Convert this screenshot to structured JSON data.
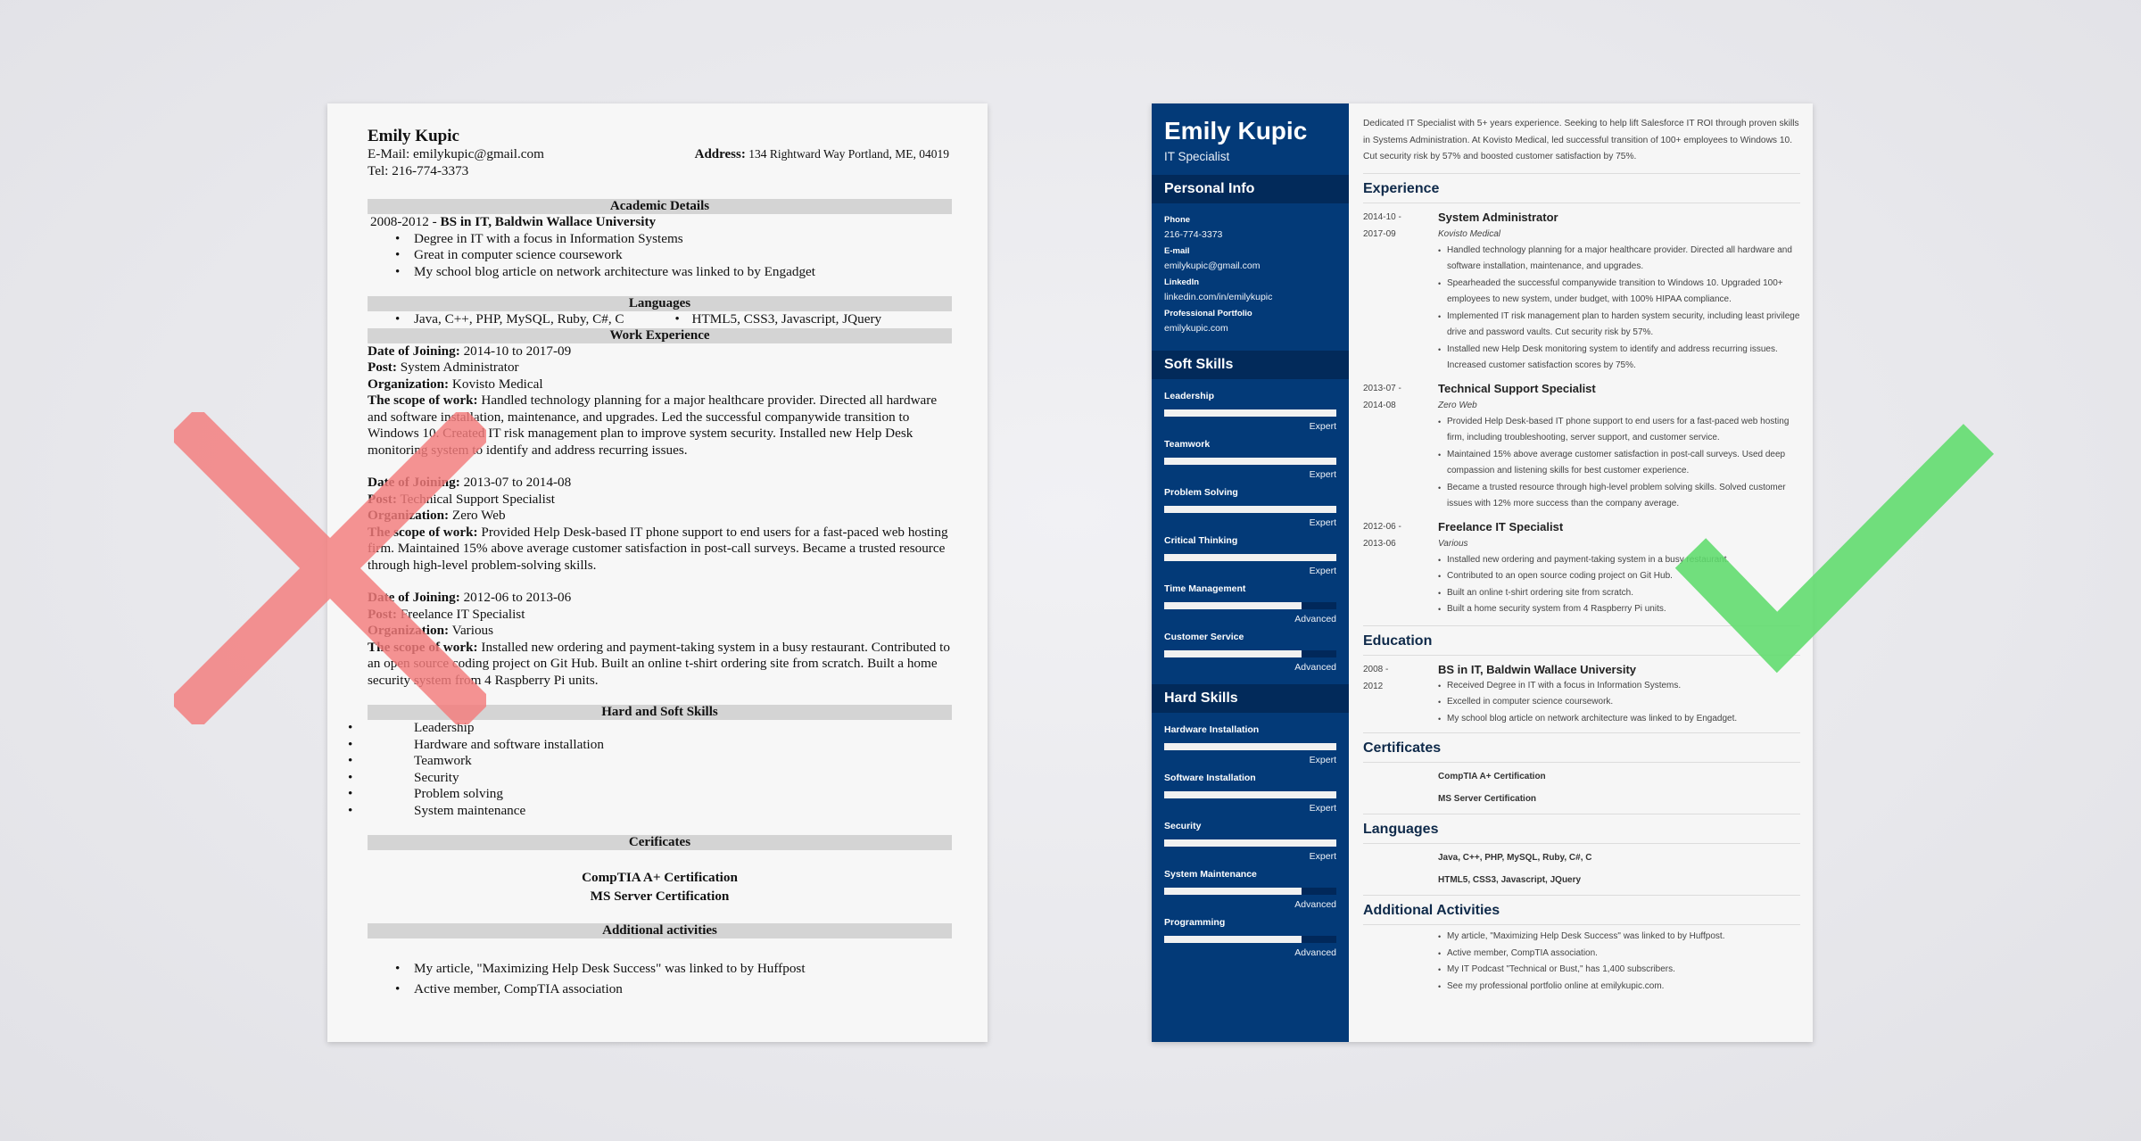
{
  "bad_resume": {
    "name": "Emily Kupic",
    "email_label": "E-Mail:",
    "email": "emilykupic@gmail.com",
    "address_label": "Address:",
    "address": "134 Rightward Way Portland, ME, 04019",
    "tel_label": "Tel:",
    "tel": "216-774-3373",
    "academic": {
      "heading": "Academic Details",
      "years": "2008-2012 - ",
      "degree": "BS in IT, Baldwin Wallace University",
      "bullets": [
        "Degree in IT with a focus in Information Systems",
        "Great in computer science coursework",
        "My school blog article on network architecture was linked to by Engadget"
      ]
    },
    "languages": {
      "heading": "Languages",
      "left": "Java, C++, PHP, MySQL, Ruby, C#, C",
      "right": "HTML5, CSS3, Javascript, JQuery"
    },
    "work": {
      "heading": "Work Experience",
      "labels": {
        "date": "Date of Joining:",
        "post": "Post:",
        "org": "Organization:",
        "scope": "The scope of work:"
      },
      "jobs": [
        {
          "dates": "2014-10 to 2017-09",
          "post": "System Administrator",
          "org": "Kovisto Medical",
          "scope": "Handled technology planning for a major healthcare provider. Directed all hardware and software installation, maintenance, and upgrades. Led the successful companywide transition to Windows 10. Created IT risk management plan to improve system security. Installed new Help Desk monitoring system to identify and address recurring issues."
        },
        {
          "dates": "2013-07 to 2014-08",
          "post": "Technical Support Specialist",
          "org": "Zero Web",
          "scope": "Provided Help Desk-based IT phone support to end users for a fast-paced web hosting firm. Maintained 15% above average customer satisfaction in post-call surveys. Became a trusted resource through high-level problem-solving skills."
        },
        {
          "dates": "2012-06 to 2013-06",
          "post": "Freelance IT Specialist",
          "org": "Various",
          "scope": "Installed new ordering and payment-taking system in a busy restaurant. Contributed to an open source coding project on Git Hub. Built an online t-shirt ordering site from scratch. Built a home security system from 4 Raspberry Pi units."
        }
      ]
    },
    "skills": {
      "heading": "Hard and Soft Skills",
      "items": [
        "Leadership",
        "Hardware and software installation",
        "Teamwork",
        "Security",
        "Problem solving",
        "System maintenance"
      ]
    },
    "certificates": {
      "heading": "Cerificates",
      "items": [
        "CompTIA A+ Certification",
        "MS Server Certification"
      ]
    },
    "activities": {
      "heading": "Additional activities",
      "items": [
        "My article, \"Maximizing Help Desk Success\" was linked to by Huffpost",
        "Active member, CompTIA association"
      ]
    }
  },
  "good_resume": {
    "sidebar": {
      "name": "Emily Kupic",
      "title": "IT Specialist",
      "personal_info": {
        "heading": "Personal Info",
        "fields": [
          {
            "label": "Phone",
            "value": "216-774-3373"
          },
          {
            "label": "E-mail",
            "value": "emilykupic@gmail.com"
          },
          {
            "label": "LinkedIn",
            "value": "linkedin.com/in/emilykupic"
          },
          {
            "label": "Professional Portfolio",
            "value": "emilykupic.com"
          }
        ]
      },
      "soft_skills": {
        "heading": "Soft Skills",
        "items": [
          {
            "name": "Leadership",
            "level": "Expert",
            "fill": 1.0
          },
          {
            "name": "Teamwork",
            "level": "Expert",
            "fill": 1.0
          },
          {
            "name": "Problem Solving",
            "level": "Expert",
            "fill": 1.0
          },
          {
            "name": "Critical Thinking",
            "level": "Expert",
            "fill": 1.0
          },
          {
            "name": "Time Management",
            "level": "Advanced",
            "fill": 0.8
          },
          {
            "name": "Customer Service",
            "level": "Advanced",
            "fill": 0.8
          }
        ]
      },
      "hard_skills": {
        "heading": "Hard Skills",
        "items": [
          {
            "name": "Hardware Installation",
            "level": "Expert",
            "fill": 1.0
          },
          {
            "name": "Software Installation",
            "level": "Expert",
            "fill": 1.0
          },
          {
            "name": "Security",
            "level": "Expert",
            "fill": 1.0
          },
          {
            "name": "System Maintenance",
            "level": "Advanced",
            "fill": 0.8
          },
          {
            "name": "Programming",
            "level": "Advanced",
            "fill": 0.8
          }
        ]
      }
    },
    "summary": "Dedicated IT Specialist with 5+ years experience. Seeking to help lift Salesforce IT ROI through proven skills in Systems Administration. At Kovisto Medical, led successful transition of 100+ employees to Windows 10. Cut security risk by 57% and boosted customer satisfaction by 75%.",
    "experience": {
      "heading": "Experience",
      "jobs": [
        {
          "date_from": "2014-10 -",
          "date_to": "2017-09",
          "role": "System Administrator",
          "org": "Kovisto Medical",
          "bullets": [
            "Handled technology planning for a major healthcare provider. Directed all hardware and software installation, maintenance, and upgrades.",
            "Spearheaded the successful companywide transition to Windows 10. Upgraded 100+ employees to new system, under budget, with 100% HIPAA compliance.",
            "Implemented IT risk management plan to harden system security, including least privilege drive and password vaults. Cut security risk by 57%.",
            "Installed new Help Desk monitoring system to identify and address recurring issues. Increased customer satisfaction scores by 75%."
          ]
        },
        {
          "date_from": "2013-07 -",
          "date_to": "2014-08",
          "role": "Technical Support Specialist",
          "org": "Zero Web",
          "bullets": [
            "Provided Help Desk-based IT phone support to end users for a fast-paced web hosting firm, including troubleshooting, server support, and customer service.",
            "Maintained 15% above average customer satisfaction in post-call surveys. Used deep compassion and listening skills for best customer experience.",
            "Became a trusted resource through high-level problem solving skills. Solved customer issues with 12% more success than the company average."
          ]
        },
        {
          "date_from": "2012-06 -",
          "date_to": "2013-06",
          "role": "Freelance IT Specialist",
          "org": "Various",
          "bullets": [
            "Installed new ordering and payment-taking system in a busy restaurant.",
            "Contributed to an open source coding project on Git Hub.",
            "Built an online t-shirt ordering site from scratch.",
            "Built a home security system from 4 Raspberry Pi units."
          ]
        }
      ]
    },
    "education": {
      "heading": "Education",
      "date_from": "2008 -",
      "date_to": "2012",
      "degree": "BS in IT, Baldwin Wallace University",
      "bullets": [
        "Received Degree in IT with a focus in Information Systems.",
        "Excelled in computer science coursework.",
        "My school blog article on network architecture was linked to by Engadget."
      ]
    },
    "certificates": {
      "heading": "Certificates",
      "items": [
        "CompTIA A+ Certification",
        "MS Server Certification"
      ]
    },
    "languages": {
      "heading": "Languages",
      "items": [
        "Java, C++, PHP, MySQL, Ruby, C#, C",
        "HTML5, CSS3, Javascript, JQuery"
      ]
    },
    "activities": {
      "heading": "Additional Activities",
      "items": [
        "My article, \"Maximizing Help Desk Success\" was linked to by Huffpost.",
        "Active member, CompTIA association.",
        "My IT Podcast \"Technical or Bust,\" has 1,400 subscribers.",
        "See my professional portfolio online at emilykupic.com."
      ]
    }
  },
  "marks": {
    "bad_icon": "x-mark-icon",
    "good_icon": "check-mark-icon",
    "bad_color": "#f47c7c",
    "good_color": "#5fdc6c"
  },
  "colors": {
    "sidebar_bg": "#033a78",
    "sidebar_heading_bg": "#022a5a",
    "left_section_bar": "#d4d4d4"
  }
}
